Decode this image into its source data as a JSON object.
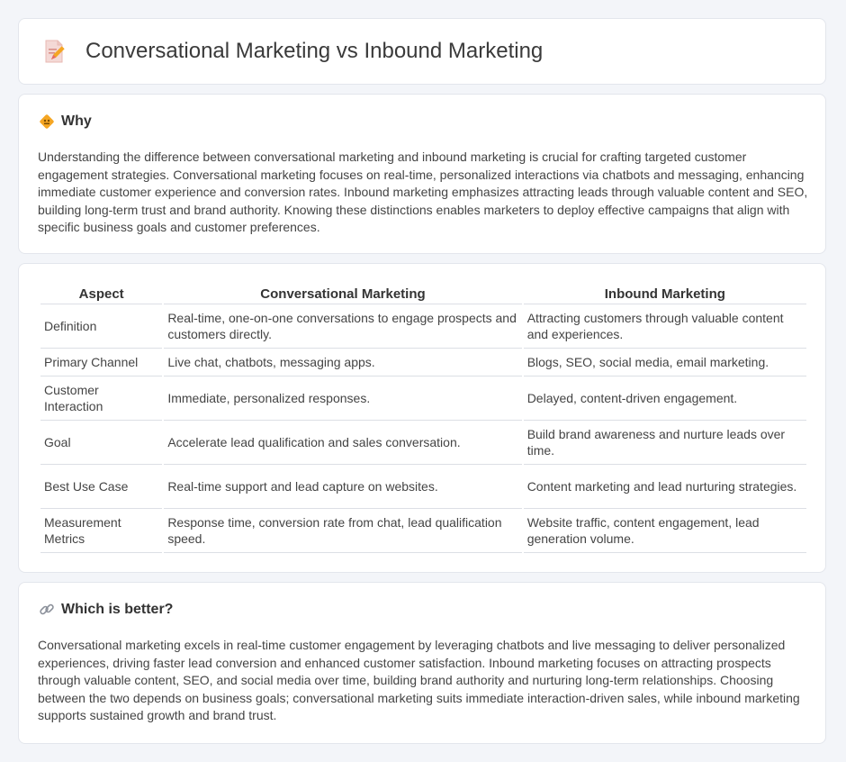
{
  "header": {
    "title": "Conversational Marketing vs Inbound Marketing",
    "icon": "document-pencil-icon"
  },
  "why": {
    "title": "Why",
    "icon": "diamond-sign-icon",
    "text": "Understanding the difference between conversational marketing and inbound marketing is crucial for crafting targeted customer engagement strategies. Conversational marketing focuses on real-time, personalized interactions via chatbots and messaging, enhancing immediate customer experience and conversion rates. Inbound marketing emphasizes attracting leads through valuable content and SEO, building long-term trust and brand authority. Knowing these distinctions enables marketers to deploy effective campaigns that align with specific business goals and customer preferences."
  },
  "table": {
    "headers": [
      "Aspect",
      "Conversational Marketing",
      "Inbound Marketing"
    ],
    "rows": [
      [
        "Definition",
        "Real-time, one-on-one conversations to engage prospects and customers directly.",
        "Attracting customers through valuable content and experiences."
      ],
      [
        "Primary Channel",
        "Live chat, chatbots, messaging apps.",
        "Blogs, SEO, social media, email marketing."
      ],
      [
        "Customer Interaction",
        "Immediate, personalized responses.",
        "Delayed, content-driven engagement."
      ],
      [
        "Goal",
        "Accelerate lead qualification and sales conversation.",
        "Build brand awareness and nurture leads over time."
      ],
      [
        "Best Use Case",
        "Real-time support and lead capture on websites.",
        "Content marketing and lead nurturing strategies."
      ],
      [
        "Measurement Metrics",
        "Response time, conversion rate from chat, lead qualification speed.",
        "Website traffic, content engagement, lead generation volume."
      ]
    ]
  },
  "better": {
    "title": "Which is better?",
    "icon": "link-icon",
    "text": "Conversational marketing excels in real-time customer engagement by leveraging chatbots and live messaging to deliver personalized experiences, driving faster lead conversion and enhanced customer satisfaction. Inbound marketing focuses on attracting prospects through valuable content, SEO, and social media over time, building brand authority and nurturing long-term relationships. Choosing between the two depends on business goals; conversational marketing suits immediate interaction-driven sales, while inbound marketing supports sustained growth and brand trust."
  },
  "colors": {
    "background": "#f3f5f9",
    "card": "#ffffff",
    "icon_orange": "#f5a623",
    "icon_pink": "#e46a6a"
  }
}
